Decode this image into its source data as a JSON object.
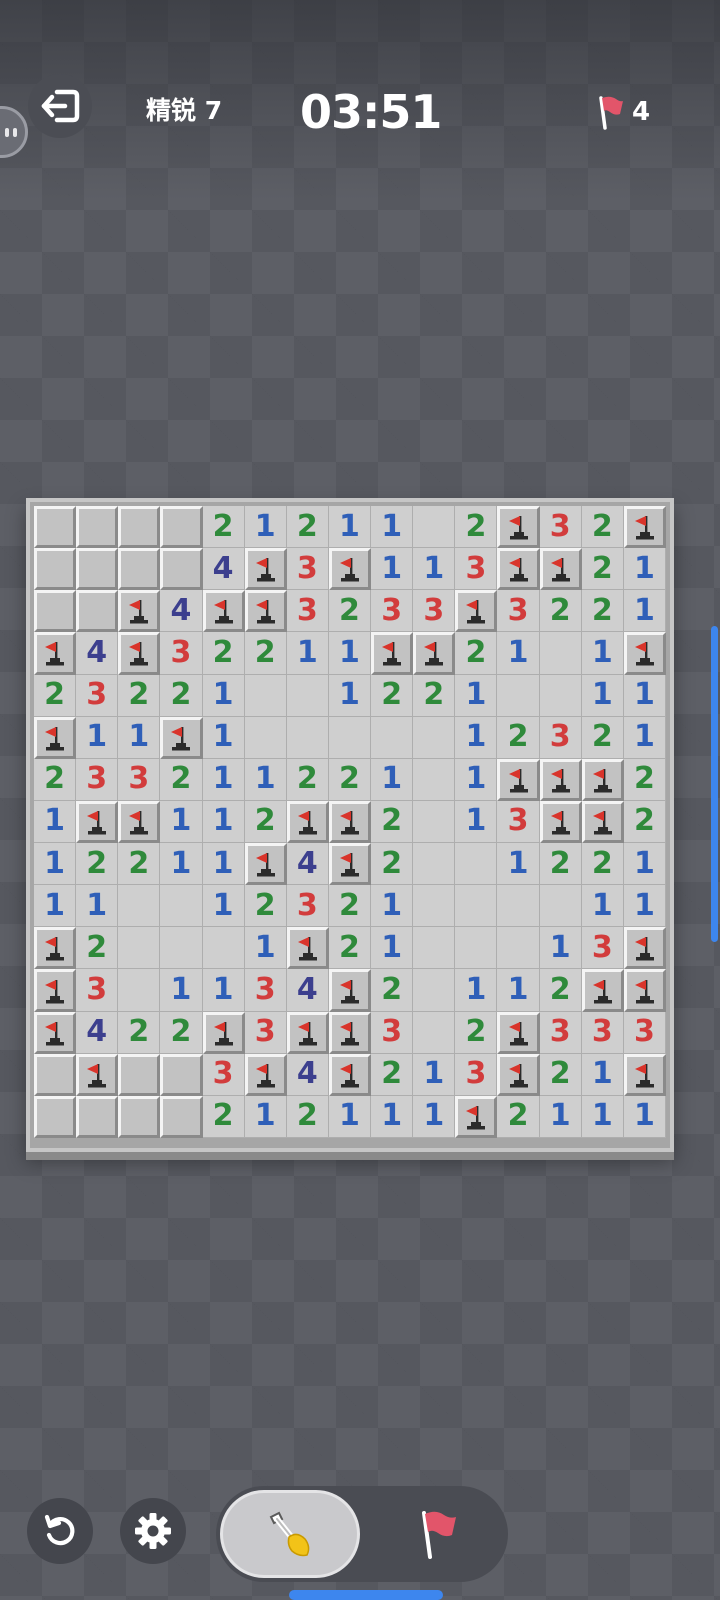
{
  "header": {
    "exit_icon": "exit-icon",
    "level_label": "精锐 7",
    "timer": "03:51",
    "flags_remaining": "4",
    "flag_icon": "flag-icon",
    "flag_color": "#e2556a"
  },
  "board": {
    "columns": 15,
    "rows_count": 15,
    "legend": "C = covered, F = flagged mine, E = empty revealed, digit = adjacent mine count",
    "rows": [
      [
        "C",
        "C",
        "C",
        "C",
        "2",
        "1",
        "2",
        "1",
        "1",
        "E",
        "2",
        "F",
        "3",
        "2",
        "F"
      ],
      [
        "C",
        "C",
        "C",
        "C",
        "4",
        "F",
        "3",
        "F",
        "1",
        "1",
        "3",
        "F",
        "F",
        "2",
        "1"
      ],
      [
        "C",
        "C",
        "F",
        "4",
        "F",
        "F",
        "3",
        "2",
        "3",
        "3",
        "F",
        "3",
        "2",
        "2",
        "1"
      ],
      [
        "F",
        "4",
        "F",
        "3",
        "2",
        "2",
        "1",
        "1",
        "F",
        "F",
        "2",
        "1",
        "E",
        "1",
        "F"
      ],
      [
        "2",
        "3",
        "2",
        "2",
        "1",
        "E",
        "E",
        "1",
        "2",
        "2",
        "1",
        "E",
        "E",
        "1",
        "1"
      ],
      [
        "F",
        "1",
        "1",
        "F",
        "1",
        "E",
        "E",
        "E",
        "E",
        "E",
        "1",
        "2",
        "3",
        "2",
        "1"
      ],
      [
        "2",
        "3",
        "3",
        "2",
        "1",
        "1",
        "2",
        "2",
        "1",
        "E",
        "1",
        "F",
        "F",
        "F",
        "2"
      ],
      [
        "1",
        "F",
        "F",
        "1",
        "1",
        "2",
        "F",
        "F",
        "2",
        "E",
        "1",
        "3",
        "F",
        "F",
        "2"
      ],
      [
        "1",
        "2",
        "2",
        "1",
        "1",
        "F",
        "4",
        "F",
        "2",
        "E",
        "E",
        "1",
        "2",
        "2",
        "1"
      ],
      [
        "1",
        "1",
        "E",
        "E",
        "1",
        "2",
        "3",
        "2",
        "1",
        "E",
        "E",
        "E",
        "E",
        "1",
        "1"
      ],
      [
        "F",
        "2",
        "E",
        "E",
        "E",
        "1",
        "F",
        "2",
        "1",
        "E",
        "E",
        "E",
        "1",
        "3",
        "F"
      ],
      [
        "F",
        "3",
        "E",
        "1",
        "1",
        "3",
        "4",
        "F",
        "2",
        "E",
        "1",
        "1",
        "2",
        "F",
        "F"
      ],
      [
        "F",
        "4",
        "2",
        "2",
        "F",
        "3",
        "F",
        "F",
        "3",
        "E",
        "2",
        "F",
        "3",
        "3",
        "3"
      ],
      [
        "C",
        "F",
        "C",
        "C",
        "3",
        "F",
        "4",
        "F",
        "2",
        "1",
        "3",
        "F",
        "2",
        "1",
        "F"
      ],
      [
        "C",
        "C",
        "C",
        "C",
        "2",
        "1",
        "2",
        "1",
        "1",
        "1",
        "F",
        "2",
        "1",
        "1",
        "1"
      ]
    ],
    "number_colors": {
      "1": "#2f5fb8",
      "2": "#2f8a3b",
      "3": "#d23c3c",
      "4": "#3c3f8e"
    },
    "flag_marker_icon": "flagged-mine-icon"
  },
  "controls": {
    "restart_icon": "restart-icon",
    "settings_icon": "settings-icon",
    "dig_mode_icon": "shovel-icon",
    "flag_mode_icon": "flag-mode-icon",
    "active_mode": "dig"
  }
}
